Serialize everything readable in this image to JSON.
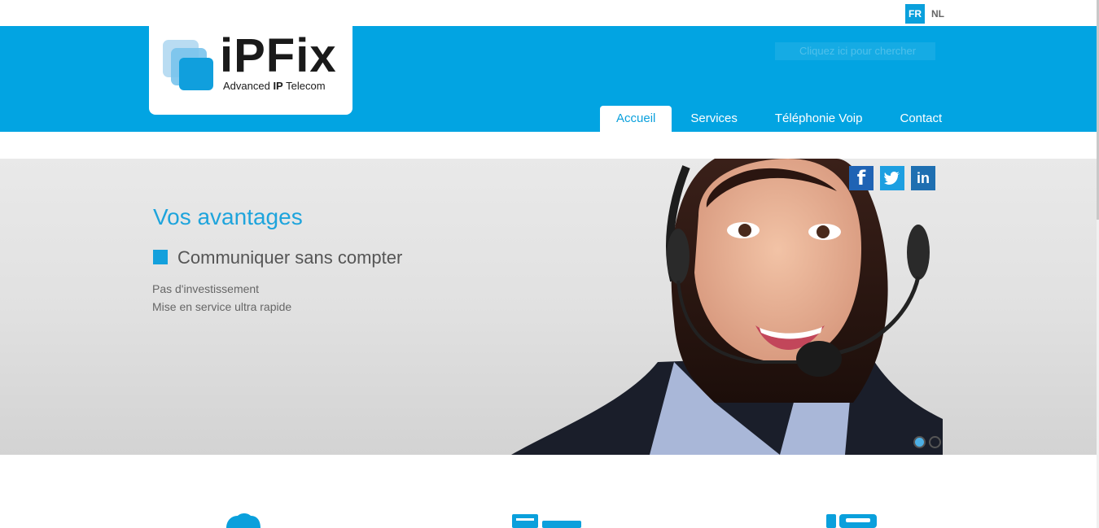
{
  "languages": [
    {
      "code": "FR",
      "active": true
    },
    {
      "code": "NL",
      "active": false
    }
  ],
  "header": {
    "search_placeholder": "Cliquez ici pour chercher"
  },
  "logo": {
    "name": "iPFix",
    "tagline_pre": "Advanced ",
    "tagline_bold": "IP",
    "tagline_post": " Telecom"
  },
  "nav": [
    {
      "label": "Accueil",
      "active": true
    },
    {
      "label": "Services",
      "active": false
    },
    {
      "label": "Téléphonie Voip",
      "active": false
    },
    {
      "label": "Contact",
      "active": false
    }
  ],
  "hero": {
    "title": "Vos avantages",
    "subtitle": "Communiquer sans compter",
    "lines": [
      "Pas d'investissement",
      "Mise en service ultra rapide"
    ]
  },
  "social": [
    {
      "name": "facebook-icon",
      "glyph": "f"
    },
    {
      "name": "twitter-icon",
      "glyph": "t"
    },
    {
      "name": "linkedin-icon",
      "glyph": "in"
    }
  ],
  "slider": {
    "slides": 2,
    "current": 1
  },
  "colors": {
    "brand_blue": "#02a4e2",
    "accent": "#1ea4dc"
  }
}
